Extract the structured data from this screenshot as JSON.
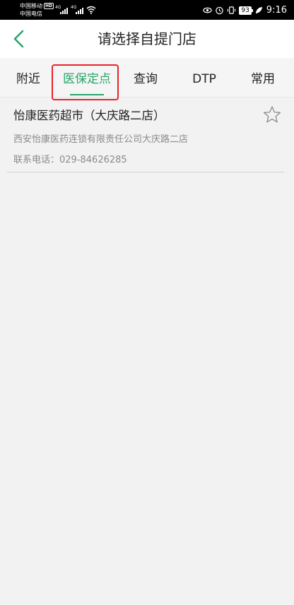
{
  "status_bar": {
    "carrier_1": "中国移动",
    "hd_badge": "HD",
    "carrier_2": "中国电信",
    "signal_1_label": "4G",
    "signal_2_label": "4G",
    "battery": "93",
    "time": "9:16"
  },
  "header": {
    "title": "请选择自提门店"
  },
  "tabs": [
    {
      "label": "附近",
      "active": false
    },
    {
      "label": "医保定点",
      "active": true
    },
    {
      "label": "查询",
      "active": false
    },
    {
      "label": "DTP",
      "active": false
    },
    {
      "label": "常用",
      "active": false
    }
  ],
  "colors": {
    "accent": "#2aa56a",
    "highlight": "#e8232a"
  },
  "stores": [
    {
      "name": "怡康医药超市（大庆路二店）",
      "address": "西安怡康医药连锁有限责任公司大庆路二店",
      "phone": "联系电话：029-84626285",
      "icon": "star-outline-icon"
    }
  ]
}
